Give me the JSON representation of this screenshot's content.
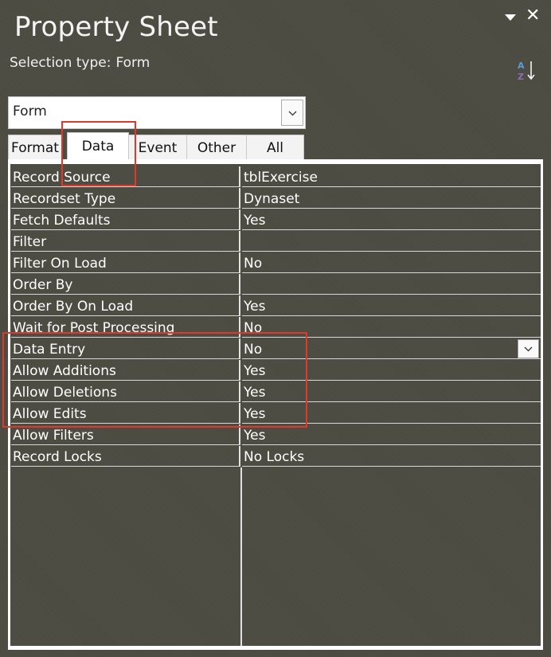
{
  "title": "Property Sheet",
  "selection": {
    "label": "Selection type:",
    "value": "Form"
  },
  "object_combo": {
    "value": "Form"
  },
  "tabs": [
    {
      "label": "Format",
      "active": false
    },
    {
      "label": "Data",
      "active": true
    },
    {
      "label": "Event",
      "active": false
    },
    {
      "label": "Other",
      "active": false
    },
    {
      "label": "All",
      "active": false
    }
  ],
  "properties": [
    {
      "name": "Record Source",
      "value": "tblExercise"
    },
    {
      "name": "Recordset Type",
      "value": "Dynaset"
    },
    {
      "name": "Fetch Defaults",
      "value": "Yes"
    },
    {
      "name": "Filter",
      "value": ""
    },
    {
      "name": "Filter On Load",
      "value": "No"
    },
    {
      "name": "Order By",
      "value": ""
    },
    {
      "name": "Order By On Load",
      "value": "Yes"
    },
    {
      "name": "Wait for Post Processing",
      "value": "No"
    },
    {
      "name": "Data Entry",
      "value": "No"
    },
    {
      "name": "Allow Additions",
      "value": "Yes"
    },
    {
      "name": "Allow Deletions",
      "value": "Yes"
    },
    {
      "name": "Allow Edits",
      "value": "Yes"
    },
    {
      "name": "Allow Filters",
      "value": "Yes"
    },
    {
      "name": "Record Locks",
      "value": "No Locks"
    }
  ],
  "icons": [
    "pin-dropdown-icon",
    "close-icon",
    "sort-az-icon",
    "chevron-down-icon"
  ],
  "colors": {
    "background": "#4c4b42",
    "highlight": "#e0392c",
    "panel": "#ffffff"
  }
}
